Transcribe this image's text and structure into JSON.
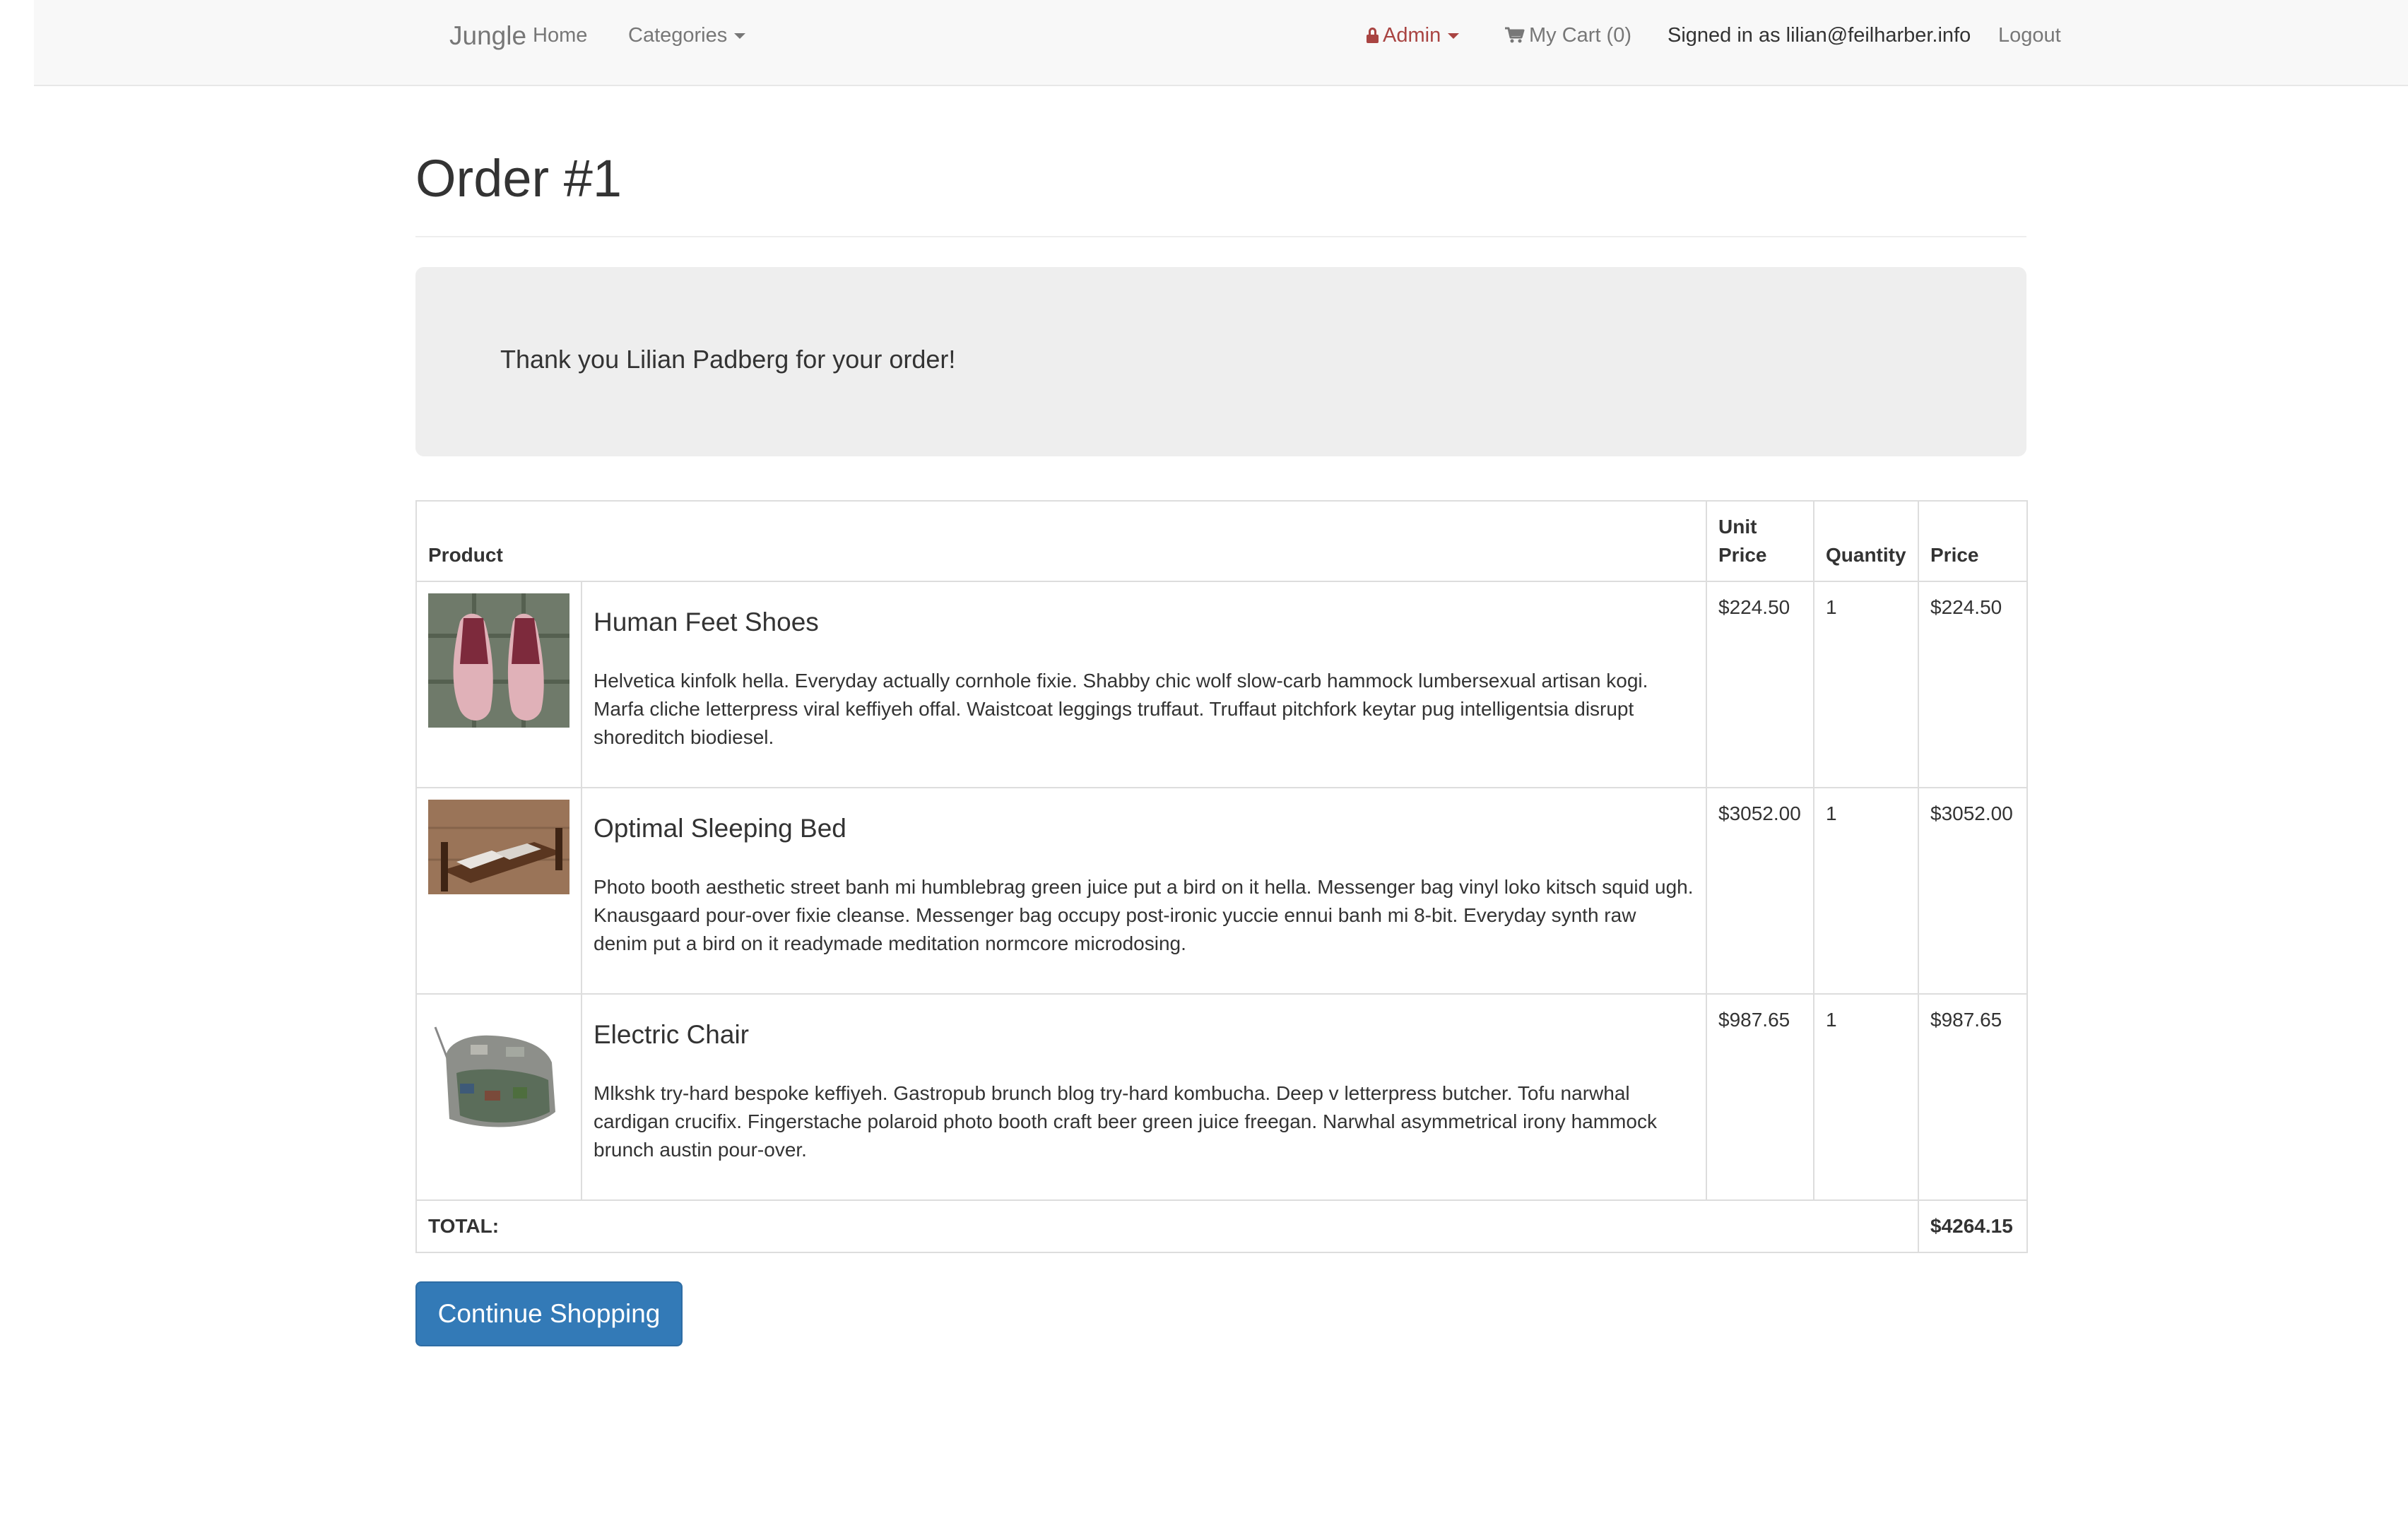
{
  "navbar": {
    "brand": "Jungle",
    "home": "Home",
    "categories": "Categories",
    "admin": "Admin",
    "cart": "My Cart (0)",
    "signed_in": "Signed in as lilian@feilharber.info",
    "logout": "Logout"
  },
  "page": {
    "title": "Order #1"
  },
  "thanks": "Thank you Lilian Padberg for your order!",
  "table": {
    "headers": {
      "product": "Product",
      "unit_price": "Unit Price",
      "quantity": "Quantity",
      "price": "Price"
    },
    "rows": [
      {
        "name": "Human Feet Shoes",
        "description": "Helvetica kinfolk hella. Everyday actually cornhole fixie. Shabby chic wolf slow-carb hammock lumbersexual artisan kogi. Marfa cliche letterpress viral keffiyeh offal. Waistcoat leggings truffaut. Truffaut pitchfork keytar pug intelligentsia disrupt shoreditch biodiesel.",
        "unit_price": "$224.50",
        "quantity": "1",
        "price": "$224.50"
      },
      {
        "name": "Optimal Sleeping Bed",
        "description": "Photo booth aesthetic street banh mi humblebrag green juice put a bird on it hella. Messenger bag vinyl loko kitsch squid ugh. Knausgaard pour-over fixie cleanse. Messenger bag occupy post-ironic yuccie ennui banh mi 8-bit. Everyday synth raw denim put a bird on it readymade meditation normcore microdosing.",
        "unit_price": "$3052.00",
        "quantity": "1",
        "price": "$3052.00"
      },
      {
        "name": "Electric Chair",
        "description": "Mlkshk try-hard bespoke keffiyeh. Gastropub brunch blog try-hard kombucha. Deep v letterpress butcher. Tofu narwhal cardigan crucifix. Fingerstache polaroid photo booth craft beer green juice freegan. Narwhal asymmetrical irony hammock brunch austin pour-over.",
        "unit_price": "$987.65",
        "quantity": "1",
        "price": "$987.65"
      }
    ],
    "total_label": "TOTAL:",
    "total_value": "$4264.15"
  },
  "button": {
    "continue": "Continue Shopping"
  },
  "colors": {
    "primary": "#337ab7",
    "admin": "#a94442",
    "navbar_bg": "#f8f8f8",
    "panel_bg": "#eeeeee"
  },
  "icons": {
    "admin": "lock-icon",
    "cart": "cart-icon",
    "dropdown": "caret-down-icon"
  }
}
